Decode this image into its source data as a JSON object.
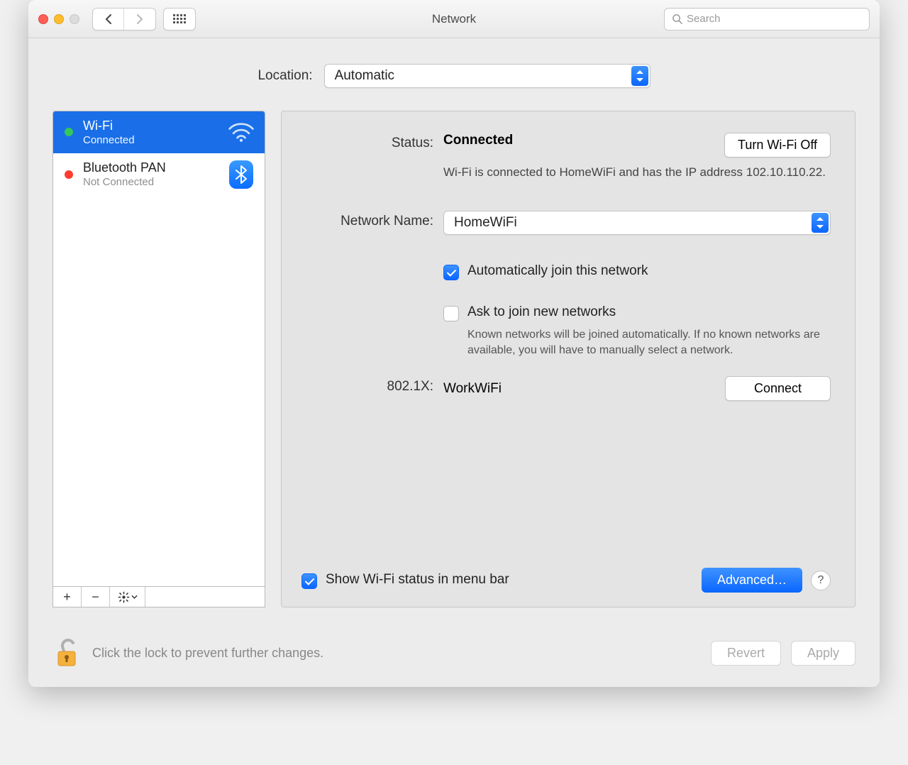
{
  "window": {
    "title": "Network",
    "search_placeholder": "Search"
  },
  "location": {
    "label": "Location:",
    "value": "Automatic"
  },
  "sidebar": {
    "items": [
      {
        "name": "Wi-Fi",
        "status": "Connected",
        "dot": "green",
        "selected": true,
        "icon": "wifi"
      },
      {
        "name": "Bluetooth PAN",
        "status": "Not Connected",
        "dot": "red",
        "selected": false,
        "icon": "bluetooth"
      }
    ]
  },
  "main": {
    "status_label": "Status:",
    "status_value": "Connected",
    "turn_off_label": "Turn Wi-Fi Off",
    "status_desc": "Wi-Fi is connected to HomeWiFi and has the IP address 102.10.110.22.",
    "network_name_label": "Network Name:",
    "network_name_value": "HomeWiFi",
    "auto_join_label": "Automatically join this network",
    "auto_join_checked": true,
    "ask_join_label": "Ask to join new networks",
    "ask_join_checked": false,
    "ask_join_helper": "Known networks will be joined automatically. If no known networks are available, you will have to manually select a network.",
    "dot1x_label": "802.1X:",
    "dot1x_value": "WorkWiFi",
    "connect_label": "Connect",
    "show_status_label": "Show Wi-Fi status in menu bar",
    "show_status_checked": true,
    "advanced_label": "Advanced…",
    "help_label": "?"
  },
  "footer": {
    "lock_text": "Click the lock to prevent further changes.",
    "revert_label": "Revert",
    "apply_label": "Apply"
  }
}
